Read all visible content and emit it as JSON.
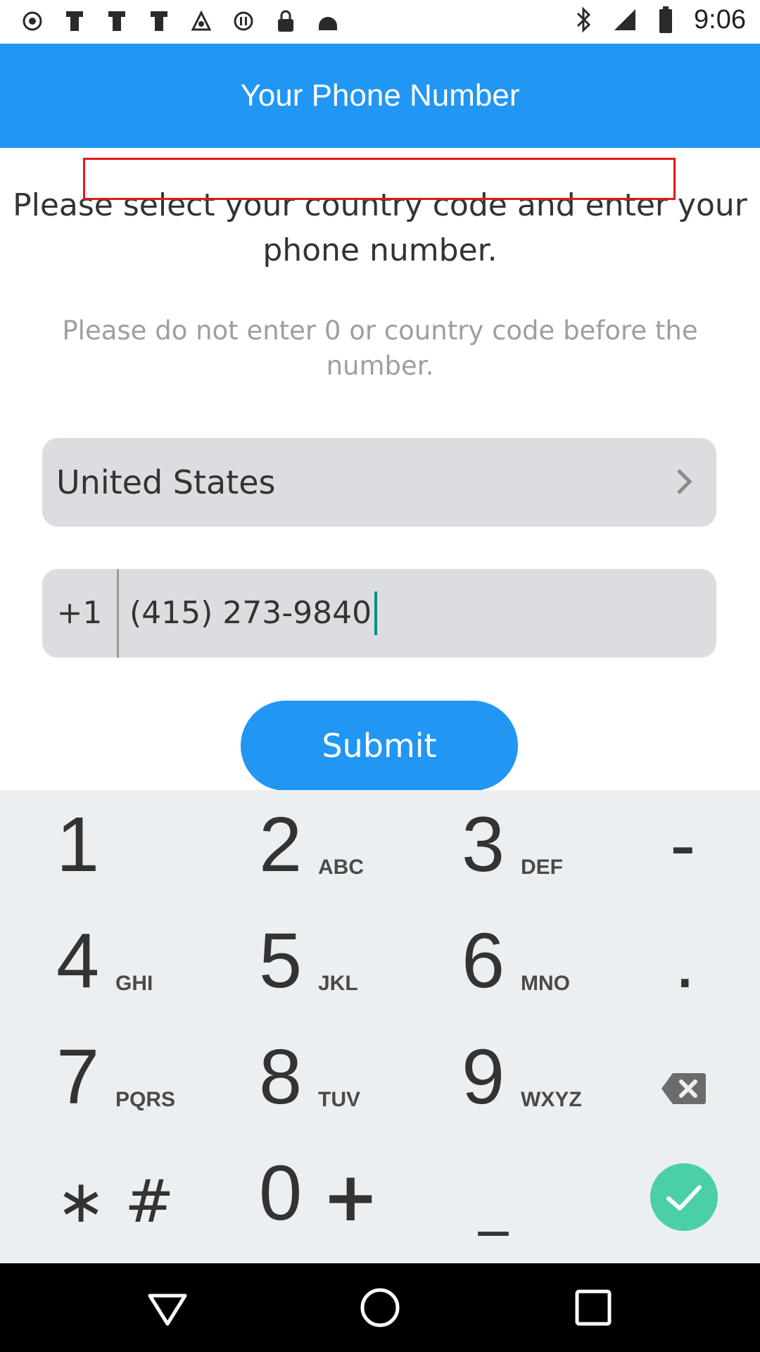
{
  "status_bar": {
    "time": "9:06",
    "left_icons": [
      "record-icon",
      "notification-icon",
      "notification-icon",
      "notification-icon",
      "fake-gps-icon",
      "pause-icon",
      "lock-icon",
      "android-icon"
    ],
    "right_icons": [
      "bluetooth-icon",
      "signal-icon",
      "battery-icon"
    ]
  },
  "header": {
    "title": "Your Phone Number"
  },
  "main": {
    "instruction": "Please select your country code and enter your phone number.",
    "note": "Please do not enter 0 or country code before the number.",
    "country": "United States",
    "country_code": "+1",
    "phone_value": "(415) 273-9840",
    "submit_label": "Submit"
  },
  "keypad": {
    "keys": [
      {
        "digit": "1",
        "letters": ""
      },
      {
        "digit": "2",
        "letters": "ABC"
      },
      {
        "digit": "3",
        "letters": "DEF"
      },
      {
        "digit": "-",
        "letters": ""
      },
      {
        "digit": "4",
        "letters": "GHI"
      },
      {
        "digit": "5",
        "letters": "JKL"
      },
      {
        "digit": "6",
        "letters": "MNO"
      },
      {
        "digit": ".",
        "letters": ""
      },
      {
        "digit": "7",
        "letters": "PQRS"
      },
      {
        "digit": "8",
        "letters": "TUV"
      },
      {
        "digit": "9",
        "letters": "WXYZ"
      },
      {
        "digit": "0",
        "letters": ""
      }
    ],
    "star_hash": "∗ #",
    "plus": "+",
    "space": "_"
  },
  "colors": {
    "primary": "#2196f3",
    "accent": "#4bcfa6",
    "highlight": "#e01b1b",
    "field_bg": "#dcdde0"
  }
}
